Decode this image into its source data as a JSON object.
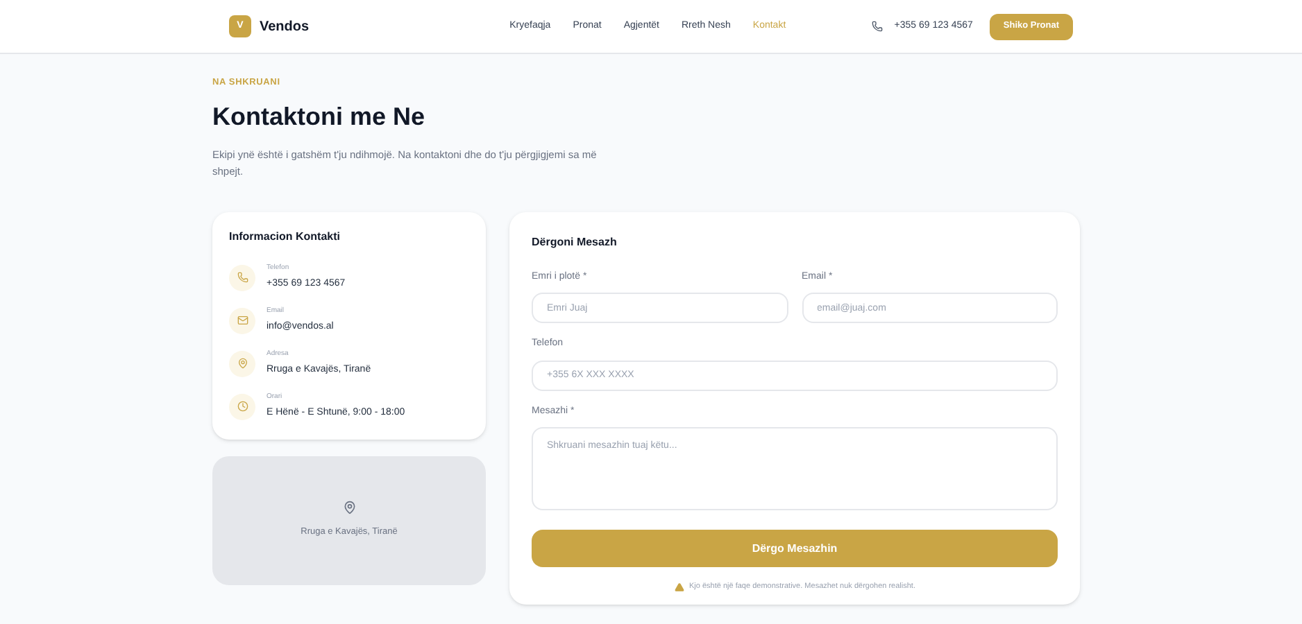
{
  "brand": {
    "logo": "V",
    "name": "Vendos"
  },
  "nav": [
    {
      "label": "Kryefaqja",
      "selected": false
    },
    {
      "label": "Pronat",
      "selected": false
    },
    {
      "label": "Agjentët",
      "selected": false
    },
    {
      "label": "Rreth Nesh",
      "selected": false
    },
    {
      "label": "Kontakt",
      "selected": true
    }
  ],
  "header_phone": "+355 69 123 4567",
  "header_button": "Shiko Pronat",
  "eyebrow": "NA SHKRUANI",
  "title": "Kontaktoni me Ne",
  "intro": "Ekipi ynë është i gatshëm t'ju ndihmojë. Na kontaktoni dhe do t'ju përgjigjemi sa më shpejt.",
  "contact_card": {
    "title": "Informacion Kontakti",
    "items": [
      {
        "kind": "phone",
        "label": "Telefon",
        "value": "+355 69 123 4567"
      },
      {
        "kind": "email",
        "label": "Email",
        "value": "info@vendos.al"
      },
      {
        "kind": "address",
        "label": "Adresa",
        "value": "Rruga e Kavajës, Tiranë"
      },
      {
        "kind": "hours",
        "label": "Orari",
        "value": "E Hënë - E Shtunë, 9:00 - 18:00"
      }
    ]
  },
  "map": {
    "address": "Rruga e Kavajës, Tiranë"
  },
  "form": {
    "title": "Dërgoni Mesazh",
    "name_field": {
      "label": "Emri i plotë *",
      "placeholder": "Emri Juaj"
    },
    "email_field": {
      "label": "Email *",
      "placeholder": "email@juaj.com"
    },
    "phone_field": {
      "label": "Telefon",
      "placeholder": "+355 6X XXX XXXX"
    },
    "message_field": {
      "label": "Mesazhi *",
      "placeholder": "Shkruani mesazhin tuaj këtu..."
    },
    "submit": "Dërgo Mesazhin",
    "note": "Kjo është një faqe demonstrative. Mesazhet nuk dërgohen realisht."
  }
}
